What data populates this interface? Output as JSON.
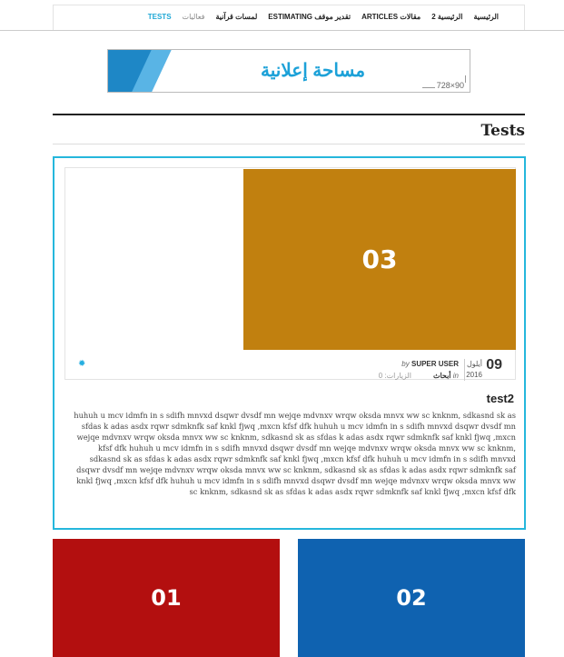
{
  "nav": {
    "items": [
      {
        "label": "الرئيسية",
        "active": false,
        "dim": false
      },
      {
        "label": "الرئيسية 2",
        "active": false,
        "dim": false
      },
      {
        "label": "ARTICLES مقالات",
        "active": false,
        "dim": false
      },
      {
        "label": "ESTIMATING تقدير موقف",
        "active": false,
        "dim": false
      },
      {
        "label": "لمسات قرآنية",
        "active": false,
        "dim": false
      },
      {
        "label": "فعاليات",
        "active": false,
        "dim": true
      },
      {
        "label": "TESTS",
        "active": true,
        "dim": false
      }
    ]
  },
  "ad": {
    "text": "مساحة إعلانية",
    "size": "728×90"
  },
  "section": {
    "title": "Tests"
  },
  "featured": {
    "image_label": "03",
    "image_color": "#c1800f",
    "gear_icon": "gear-icon",
    "day": "09",
    "month": "أيلول",
    "year": "2016",
    "by_prefix": "by",
    "author": "SUPER USER",
    "in_prefix": "in",
    "category": "أبحاث",
    "visits": "الزيارات: 0",
    "title": "test2",
    "body": "huhuh u mcv idmfn in s sdifh mnvxd dsqwr dvsdf mn wejqe  mdvnxv wrqw oksda mnvx ww sc knknm,  sdkasnd sk as sfdas k adas asdx rqwr sdmknfk saf knkl fjwq ,mxcn kfsf dfk huhuh u mcv idmfn in s sdifh mnvxd dsqwr dvsdf mn wejqe  mdvnxv wrqw oksda mnvx ww sc knknm,  sdkasnd sk as sfdas k adas asdx rqwr sdmknfk saf knkl fjwq ,mxcn kfsf dfk huhuh u mcv idmfn in s sdifh mnvxd dsqwr dvsdf mn wejqe  mdvnxv wrqw oksda mnvx ww sc knknm,  sdkasnd sk as sfdas k adas asdx rqwr sdmknfk saf knkl fjwq ,mxcn kfsf dfk huhuh u mcv idmfn in s sdifh mnvxd dsqwr dvsdf mn wejqe  mdvnxv wrqw oksda mnvx ww sc knknm,  sdkasnd sk as sfdas k adas asdx rqwr sdmknfk saf knkl fjwq ,mxcn kfsf dfk huhuh u mcv idmfn in s sdifh mnvxd dsqwr dvsdf mn wejqe  mdvnxv wrqw oksda mnvx ww sc knknm,  sdkasnd sk as sfdas k adas asdx rqwr sdmknfk saf knkl fjwq ,mxcn kfsf dfk"
  },
  "tiles": [
    {
      "label": "01",
      "color": "#b30f0f"
    },
    {
      "label": "02",
      "color": "#0f62b0"
    }
  ]
}
